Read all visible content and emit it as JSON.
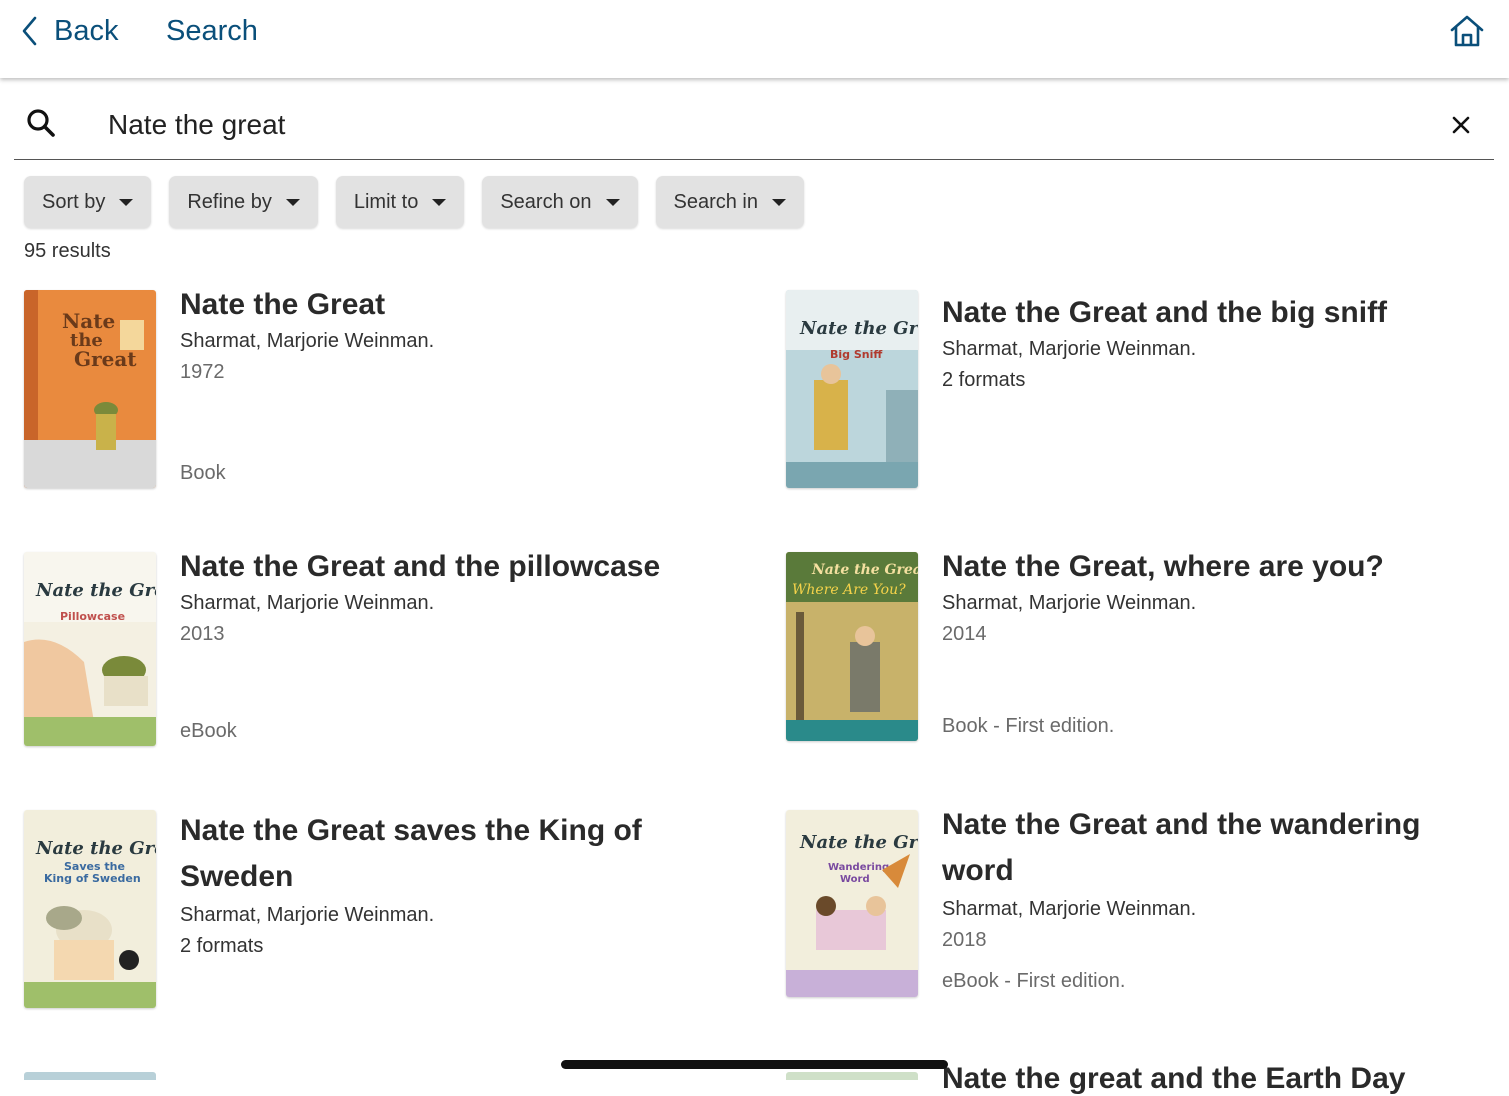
{
  "nav": {
    "back_label": "Back",
    "title": "Search"
  },
  "search": {
    "query": "Nate the great"
  },
  "filters": [
    "Sort by",
    "Refine by",
    "Limit to",
    "Search on",
    "Search in"
  ],
  "results_count": "95 results",
  "results": [
    {
      "title": "Nate the Great",
      "author": "Sharmat, Marjorie Weinman.",
      "year": "1972",
      "format": "Book"
    },
    {
      "title": "Nate the Great and the big sniff",
      "author": "Sharmat, Marjorie Weinman.",
      "formats": "2 formats"
    },
    {
      "title": "Nate the Great and the pillowcase",
      "author": "Sharmat, Marjorie Weinman.",
      "year": "2013",
      "format": "eBook"
    },
    {
      "title": "Nate the Great, where are you?",
      "author": "Sharmat, Marjorie Weinman.",
      "year": "2014",
      "format": "Book - First edition."
    },
    {
      "title": "Nate the Great saves the King of Sweden",
      "author": "Sharmat, Marjorie Weinman.",
      "formats": "2 formats"
    },
    {
      "title": "Nate the Great and the wandering word",
      "author": "Sharmat, Marjorie Weinman.",
      "year": "2018",
      "format": "eBook - First edition."
    },
    {
      "title": "Nate the great and the Earth Day"
    }
  ],
  "colors": {
    "link": "#0a4f7a",
    "chip": "#e2e2e2"
  }
}
